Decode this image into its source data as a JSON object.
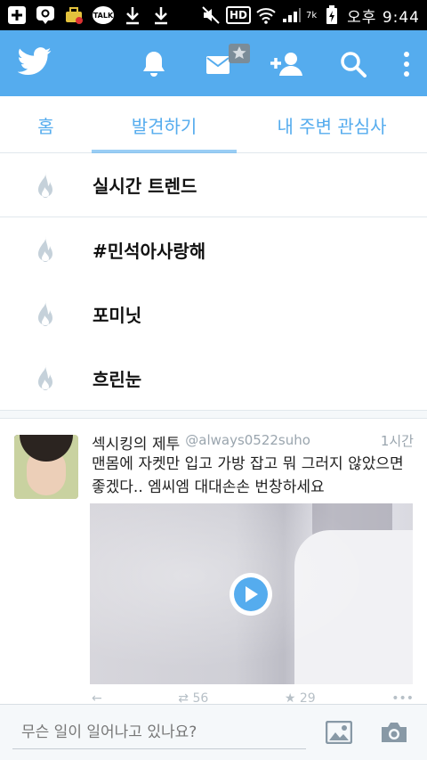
{
  "status_bar": {
    "talk_label": "TALK",
    "hd_label": "HD",
    "carrier_mark": "7k",
    "time": "오후 9:44"
  },
  "topbar": {
    "color": "#55acee"
  },
  "tabs": [
    {
      "label": "홈",
      "active": false
    },
    {
      "label": "발견하기",
      "active": true
    },
    {
      "label": "내 주변 관심사",
      "active": false
    }
  ],
  "trends": {
    "header": "실시간 트렌드",
    "items": [
      "#민석아사랑해",
      "포미닛",
      "흐린눈"
    ]
  },
  "tweet": {
    "name": "섹시킹의 제투",
    "handle": "@always0522suho",
    "time": "1시간",
    "text": "맨몸에 자켓만 입고 가방 잡고 뭐 그러지 않았으면 좋겠다.. 엠씨엠 대대손손 번창하세요",
    "retweets": "56",
    "likes": "29"
  },
  "composer": {
    "placeholder": "무슨 일이 일어나고 있나요?"
  }
}
